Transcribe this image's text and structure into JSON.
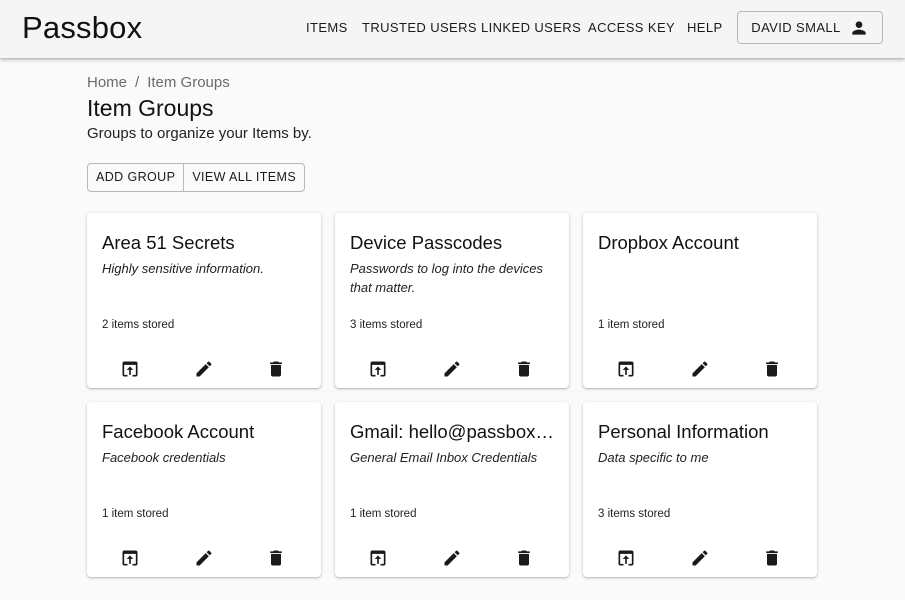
{
  "app": {
    "name": "Passbox"
  },
  "nav": {
    "items": [
      {
        "label": "ITEMS"
      },
      {
        "label": "TRUSTED USERS"
      },
      {
        "label": "LINKED USERS"
      },
      {
        "label": "ACCESS KEY"
      },
      {
        "label": "HELP"
      }
    ],
    "user": {
      "label": "DAVID SMALL",
      "icon": "person-icon"
    }
  },
  "breadcrumb": {
    "home": "Home",
    "separator": "/",
    "current": "Item Groups"
  },
  "page": {
    "title": "Item Groups",
    "subtitle": "Groups to organize your Items by."
  },
  "toolbar": {
    "add_group": "ADD GROUP",
    "view_all_items": "VIEW ALL ITEMS"
  },
  "groups": [
    {
      "title": "Area 51 Secrets",
      "description": "Highly sensitive information.",
      "count": "2 items stored"
    },
    {
      "title": "Device Passcodes",
      "description": "Passwords to log into the devices that matter.",
      "count": "3 items stored"
    },
    {
      "title": "Dropbox Account",
      "description": "",
      "count": "1 item stored"
    },
    {
      "title": "Facebook Account",
      "description": "Facebook credentials",
      "count": "1 item stored"
    },
    {
      "title": "Gmail: hello@passbox.app",
      "description": "General Email Inbox Credentials",
      "count": "1 item stored"
    },
    {
      "title": "Personal Information",
      "description": "Data specific to me",
      "count": "3 items stored"
    }
  ],
  "card_actions": [
    "open-in-new-icon",
    "edit-icon",
    "delete-icon"
  ],
  "colors": {
    "background": "#fafafa",
    "appbar": "#f5f5f5",
    "card": "#ffffff",
    "text": "#1a1a1a"
  }
}
